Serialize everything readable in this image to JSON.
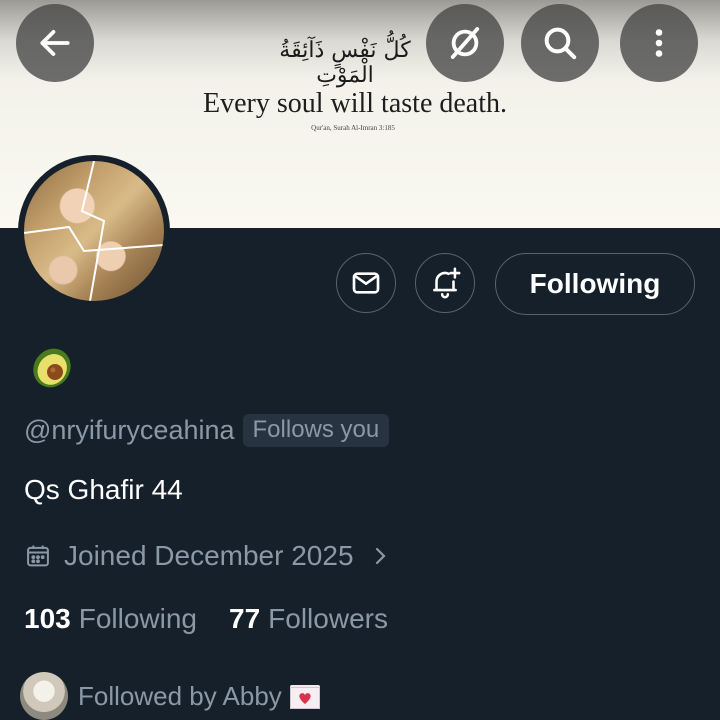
{
  "banner": {
    "arabic_text": "كُلُّ نَفْسٍ ذَآئِقَةُ الْمَوْتِ",
    "quote": "Every soul will taste death.",
    "citation": "Qur'an, Surah Al-Imran 3:185"
  },
  "header_icons": {
    "back": "arrow-left-icon",
    "grok": "slash-circle-icon",
    "search": "search-icon",
    "more": "more-vertical-icon"
  },
  "profile": {
    "display_name_emoji": "avocado",
    "handle": "@nryifuryceahina",
    "follows_you": "Follows you",
    "bio": "Qs Ghafir 44",
    "joined": "Joined December 2025",
    "following_count": "103",
    "following_label": "Following",
    "followers_count": "77",
    "followers_label": "Followers",
    "followed_by": "Followed by Abby"
  },
  "actions": {
    "following_button": "Following"
  },
  "colors": {
    "background": "#15202b",
    "muted_text": "#8b98a5",
    "border": "#566370",
    "badge_bg": "#273340"
  }
}
